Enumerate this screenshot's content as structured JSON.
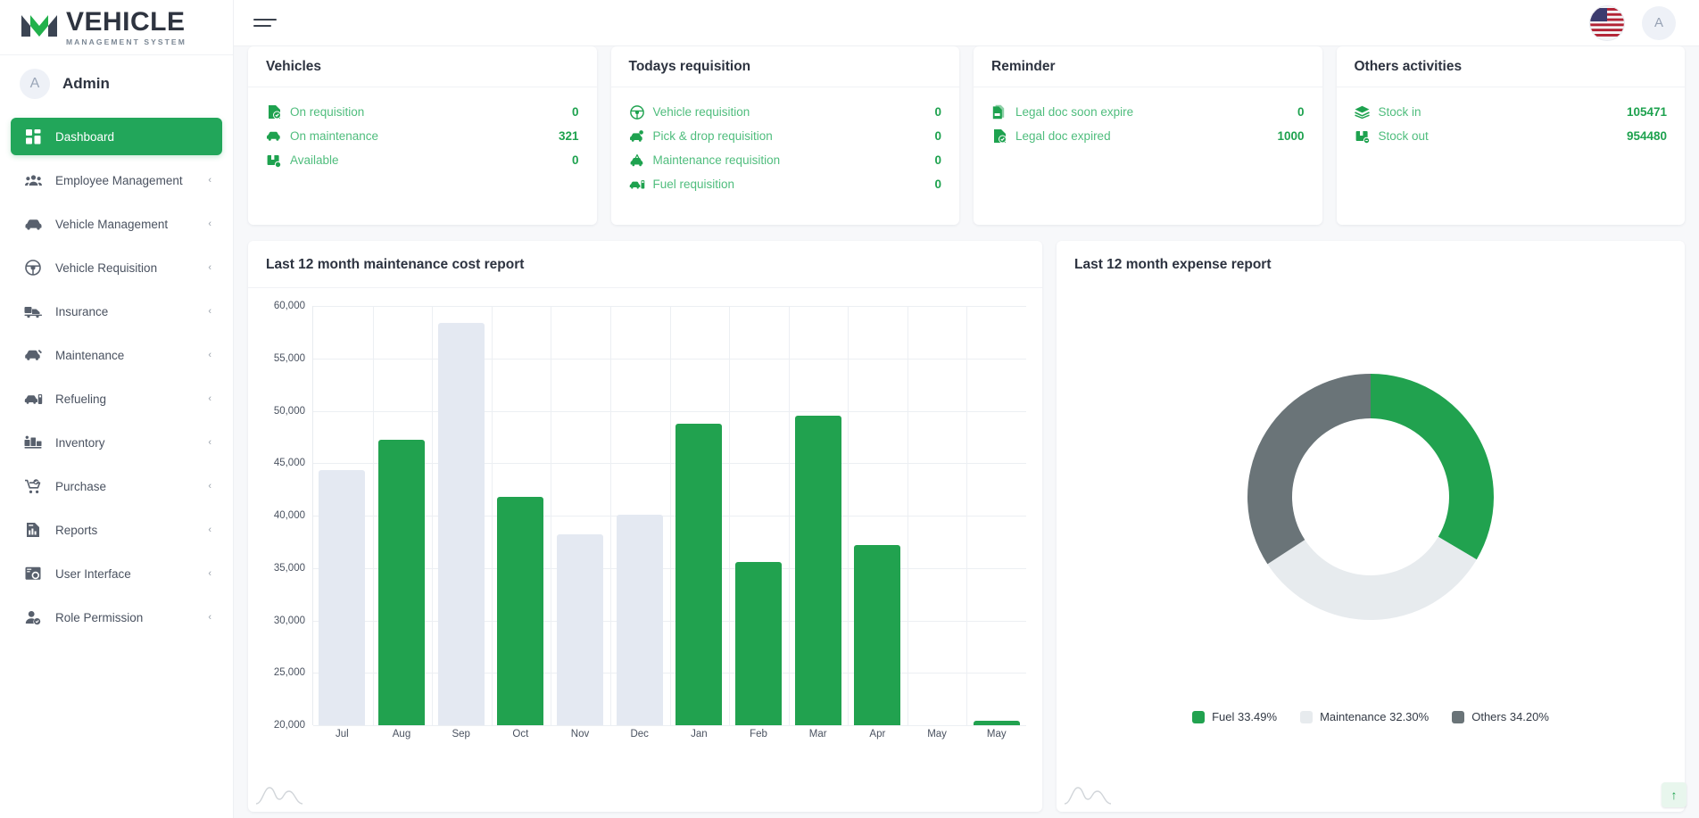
{
  "brand": {
    "title": "VEHICLE",
    "subtitle": "MANAGEMENT SYSTEM"
  },
  "user": {
    "initial": "A",
    "name": "Admin"
  },
  "header": {
    "flag": "us-flag-icon",
    "avatar_initial": "A",
    "menu_icon": "hamburger-icon"
  },
  "sidebar": {
    "items": [
      {
        "label": "Dashboard",
        "icon": "dashboard-icon",
        "active": true,
        "caret": ""
      },
      {
        "label": "Employee Management",
        "icon": "people-icon",
        "active": false,
        "caret": "‹"
      },
      {
        "label": "Vehicle Management",
        "icon": "car-icon",
        "active": false,
        "caret": "‹"
      },
      {
        "label": "Vehicle Requisition",
        "icon": "steering-wheel-icon",
        "active": false,
        "caret": "‹"
      },
      {
        "label": "Insurance",
        "icon": "insurance-truck-icon",
        "active": false,
        "caret": "‹"
      },
      {
        "label": "Maintenance",
        "icon": "car-repair-icon",
        "active": false,
        "caret": "‹"
      },
      {
        "label": "Refueling",
        "icon": "fuel-pump-icon",
        "active": false,
        "caret": "‹"
      },
      {
        "label": "Inventory",
        "icon": "inventory-icon",
        "active": false,
        "caret": "‹"
      },
      {
        "label": "Purchase",
        "icon": "shopping-cart-icon",
        "active": false,
        "caret": "‹"
      },
      {
        "label": "Reports",
        "icon": "report-document-icon",
        "active": false,
        "caret": "‹"
      },
      {
        "label": "User Interface",
        "icon": "user-interface-icon",
        "active": false,
        "caret": "‹"
      },
      {
        "label": "Role Permission",
        "icon": "user-role-icon",
        "active": false,
        "caret": "‹"
      }
    ]
  },
  "cards": [
    {
      "title": "Vehicles",
      "rows": [
        {
          "label": "On requisition",
          "value": "0",
          "icon": "doc-check-icon"
        },
        {
          "label": "On maintenance",
          "value": "321",
          "icon": "car-repair-icon"
        },
        {
          "label": "Available",
          "value": "0",
          "icon": "box-check-icon"
        }
      ]
    },
    {
      "title": "Todays requisition",
      "rows": [
        {
          "label": "Vehicle requisition",
          "value": "0",
          "icon": "steering-wheel-icon"
        },
        {
          "label": "Pick & drop requisition",
          "value": "0",
          "icon": "car-pin-icon"
        },
        {
          "label": "Maintenance requisition",
          "value": "0",
          "icon": "car-tools-icon"
        },
        {
          "label": "Fuel requisition",
          "value": "0",
          "icon": "fuel-pump-icon"
        }
      ]
    },
    {
      "title": "Reminder",
      "rows": [
        {
          "label": "Legal doc soon expire",
          "value": "0",
          "icon": "doc-stack-icon"
        },
        {
          "label": "Legal doc expired",
          "value": "1000",
          "icon": "doc-check-icon"
        }
      ]
    },
    {
      "title": "Others activities",
      "rows": [
        {
          "label": "Stock in",
          "value": "105471",
          "icon": "stack-layers-icon"
        },
        {
          "label": "Stock out",
          "value": "954480",
          "icon": "box-out-icon"
        }
      ]
    }
  ],
  "chart_data": [
    {
      "type": "bar",
      "title": "Last 12 month maintenance cost report",
      "xlabel": "",
      "ylabel": "",
      "ylim": [
        20000,
        60000
      ],
      "yticks": [
        "20,000",
        "25,000",
        "30,000",
        "35,000",
        "40,000",
        "45,000",
        "50,000",
        "55,000",
        "60,000"
      ],
      "grid": true,
      "categories": [
        "Jul",
        "Aug",
        "Sep",
        "Oct",
        "Nov",
        "Dec",
        "Jan",
        "Feb",
        "Mar",
        "Apr",
        "May",
        "May"
      ],
      "values": [
        44300,
        47200,
        58400,
        41800,
        38200,
        40100,
        48800,
        35600,
        49500,
        37200,
        0,
        20400
      ],
      "bar_colors": [
        "#e4e9f2",
        "#21a24f",
        "#e4e9f2",
        "#21a24f",
        "#e4e9f2",
        "#e4e9f2",
        "#21a24f",
        "#21a24f",
        "#21a24f",
        "#21a24f",
        "#21a24f",
        "#21a24f"
      ],
      "colors": {
        "highlight": "#21a24f",
        "muted": "#e4e9f2"
      }
    },
    {
      "type": "pie",
      "title": "Last 12 month expense report",
      "donut": true,
      "labels": [
        "Fuel",
        "Maintenance",
        "Others"
      ],
      "values": [
        33.49,
        32.3,
        34.2
      ],
      "legend_text": [
        "Fuel 33.49%",
        "Maintenance 32.30%",
        "Others 34.20%"
      ],
      "colors": [
        "#21a24f",
        "#e7ebee",
        "#6a7478"
      ],
      "legend_position": "bottom"
    }
  ],
  "scroll_top": {
    "icon": "arrow-up-icon",
    "label": "↑"
  }
}
